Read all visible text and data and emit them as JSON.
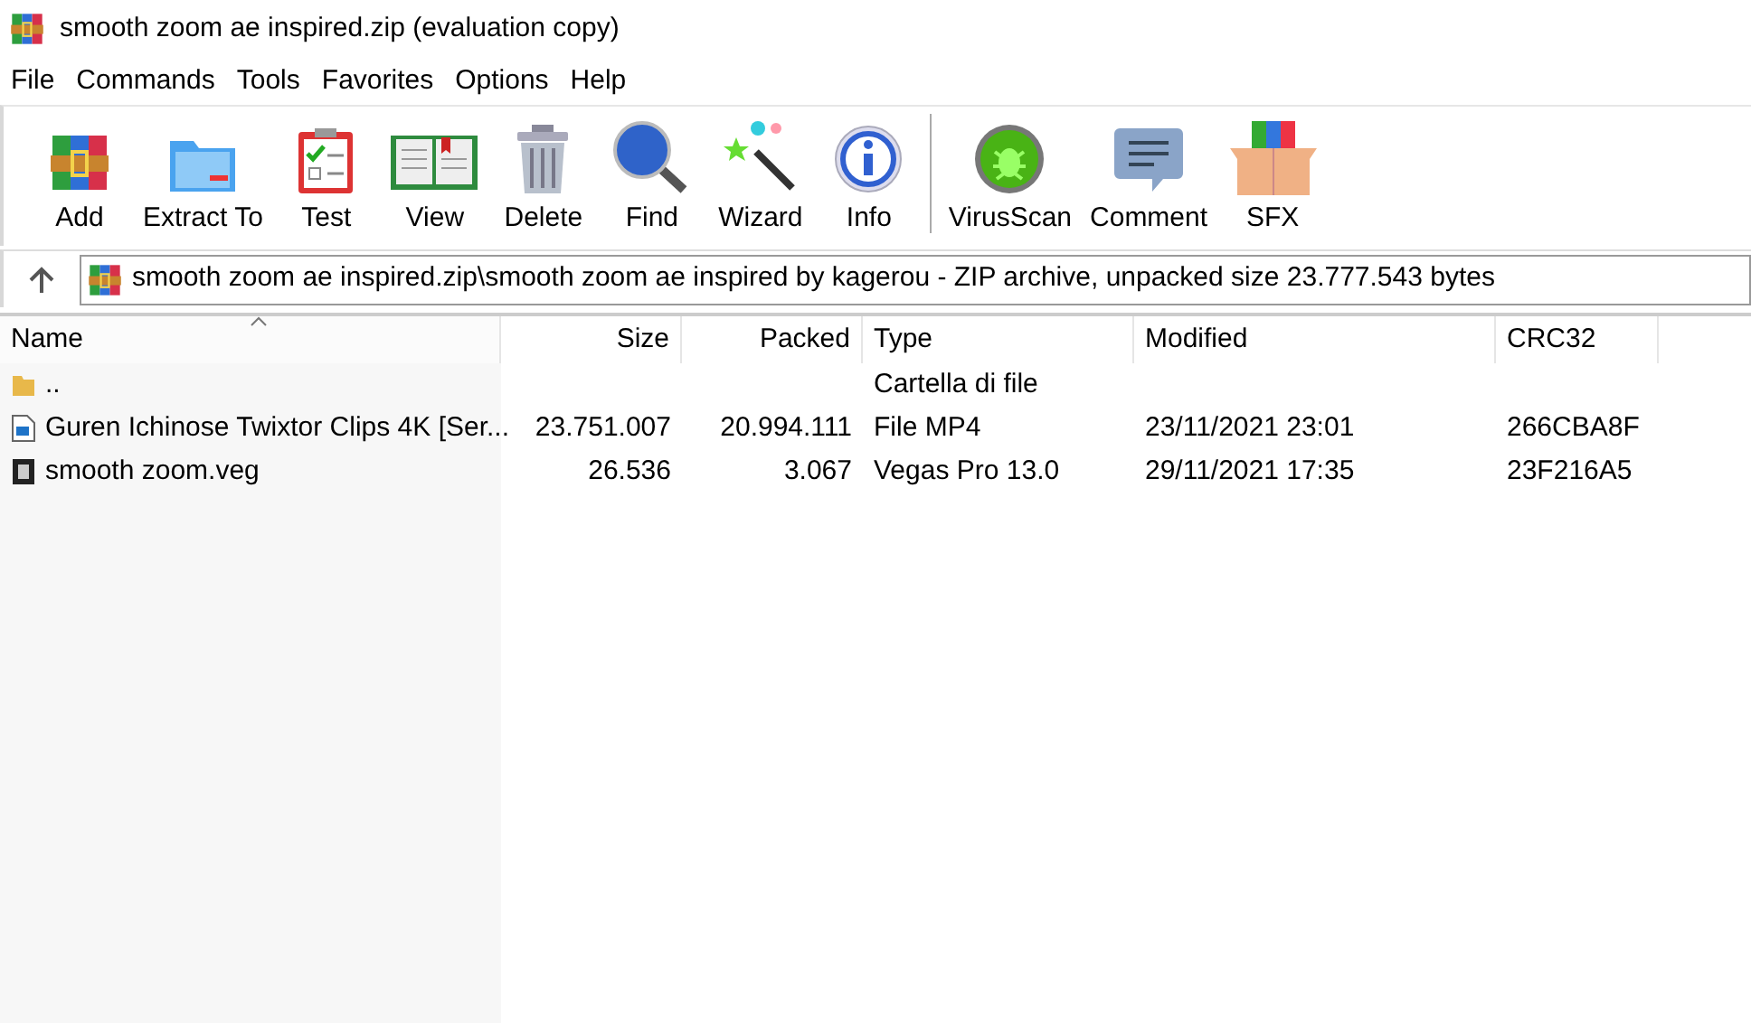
{
  "window": {
    "title": "smooth zoom ae inspired.zip (evaluation copy)"
  },
  "menu": [
    "File",
    "Commands",
    "Tools",
    "Favorites",
    "Options",
    "Help"
  ],
  "toolbar": [
    {
      "label": "Add"
    },
    {
      "label": "Extract To"
    },
    {
      "label": "Test"
    },
    {
      "label": "View"
    },
    {
      "label": "Delete"
    },
    {
      "label": "Find"
    },
    {
      "label": "Wizard"
    },
    {
      "label": "Info"
    },
    {
      "label": "VirusScan"
    },
    {
      "label": "Comment"
    },
    {
      "label": "SFX"
    }
  ],
  "address": {
    "path": "smooth zoom ae inspired.zip\\smooth zoom ae inspired by kagerou - ZIP archive, unpacked size 23.777.543 bytes"
  },
  "table": {
    "columns": [
      {
        "label": "Name",
        "sorted": true
      },
      {
        "label": "Size",
        "sorted": false
      },
      {
        "label": "Packed",
        "sorted": false
      },
      {
        "label": "Type",
        "sorted": false
      },
      {
        "label": "Modified",
        "sorted": false
      },
      {
        "label": "CRC32",
        "sorted": false
      }
    ],
    "rows": [
      {
        "kind": "folder",
        "cells": [
          "..",
          "",
          "",
          "Cartella di file",
          "",
          ""
        ]
      },
      {
        "kind": "video",
        "cells": [
          "Guren Ichinose Twixtor Clips 4K [Ser...",
          "23.751.007",
          "20.994.111",
          "File MP4",
          "23/11/2021 23:01",
          "266CBA8F"
        ]
      },
      {
        "kind": "film",
        "cells": [
          "smooth zoom.veg",
          "26.536",
          "3.067",
          "Vegas Pro 13.0",
          "29/11/2021 17:35",
          "23F216A5"
        ]
      }
    ]
  }
}
